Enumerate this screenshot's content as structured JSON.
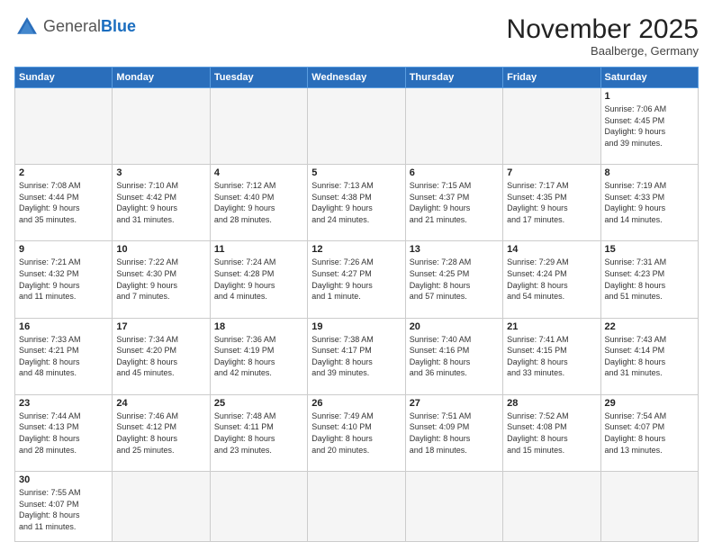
{
  "header": {
    "logo_general": "General",
    "logo_blue": "Blue",
    "month_title": "November 2025",
    "location": "Baalberge, Germany"
  },
  "weekdays": [
    "Sunday",
    "Monday",
    "Tuesday",
    "Wednesday",
    "Thursday",
    "Friday",
    "Saturday"
  ],
  "weeks": [
    [
      {
        "day": "",
        "info": ""
      },
      {
        "day": "",
        "info": ""
      },
      {
        "day": "",
        "info": ""
      },
      {
        "day": "",
        "info": ""
      },
      {
        "day": "",
        "info": ""
      },
      {
        "day": "",
        "info": ""
      },
      {
        "day": "1",
        "info": "Sunrise: 7:06 AM\nSunset: 4:45 PM\nDaylight: 9 hours\nand 39 minutes."
      }
    ],
    [
      {
        "day": "2",
        "info": "Sunrise: 7:08 AM\nSunset: 4:44 PM\nDaylight: 9 hours\nand 35 minutes."
      },
      {
        "day": "3",
        "info": "Sunrise: 7:10 AM\nSunset: 4:42 PM\nDaylight: 9 hours\nand 31 minutes."
      },
      {
        "day": "4",
        "info": "Sunrise: 7:12 AM\nSunset: 4:40 PM\nDaylight: 9 hours\nand 28 minutes."
      },
      {
        "day": "5",
        "info": "Sunrise: 7:13 AM\nSunset: 4:38 PM\nDaylight: 9 hours\nand 24 minutes."
      },
      {
        "day": "6",
        "info": "Sunrise: 7:15 AM\nSunset: 4:37 PM\nDaylight: 9 hours\nand 21 minutes."
      },
      {
        "day": "7",
        "info": "Sunrise: 7:17 AM\nSunset: 4:35 PM\nDaylight: 9 hours\nand 17 minutes."
      },
      {
        "day": "8",
        "info": "Sunrise: 7:19 AM\nSunset: 4:33 PM\nDaylight: 9 hours\nand 14 minutes."
      }
    ],
    [
      {
        "day": "9",
        "info": "Sunrise: 7:21 AM\nSunset: 4:32 PM\nDaylight: 9 hours\nand 11 minutes."
      },
      {
        "day": "10",
        "info": "Sunrise: 7:22 AM\nSunset: 4:30 PM\nDaylight: 9 hours\nand 7 minutes."
      },
      {
        "day": "11",
        "info": "Sunrise: 7:24 AM\nSunset: 4:28 PM\nDaylight: 9 hours\nand 4 minutes."
      },
      {
        "day": "12",
        "info": "Sunrise: 7:26 AM\nSunset: 4:27 PM\nDaylight: 9 hours\nand 1 minute."
      },
      {
        "day": "13",
        "info": "Sunrise: 7:28 AM\nSunset: 4:25 PM\nDaylight: 8 hours\nand 57 minutes."
      },
      {
        "day": "14",
        "info": "Sunrise: 7:29 AM\nSunset: 4:24 PM\nDaylight: 8 hours\nand 54 minutes."
      },
      {
        "day": "15",
        "info": "Sunrise: 7:31 AM\nSunset: 4:23 PM\nDaylight: 8 hours\nand 51 minutes."
      }
    ],
    [
      {
        "day": "16",
        "info": "Sunrise: 7:33 AM\nSunset: 4:21 PM\nDaylight: 8 hours\nand 48 minutes."
      },
      {
        "day": "17",
        "info": "Sunrise: 7:34 AM\nSunset: 4:20 PM\nDaylight: 8 hours\nand 45 minutes."
      },
      {
        "day": "18",
        "info": "Sunrise: 7:36 AM\nSunset: 4:19 PM\nDaylight: 8 hours\nand 42 minutes."
      },
      {
        "day": "19",
        "info": "Sunrise: 7:38 AM\nSunset: 4:17 PM\nDaylight: 8 hours\nand 39 minutes."
      },
      {
        "day": "20",
        "info": "Sunrise: 7:40 AM\nSunset: 4:16 PM\nDaylight: 8 hours\nand 36 minutes."
      },
      {
        "day": "21",
        "info": "Sunrise: 7:41 AM\nSunset: 4:15 PM\nDaylight: 8 hours\nand 33 minutes."
      },
      {
        "day": "22",
        "info": "Sunrise: 7:43 AM\nSunset: 4:14 PM\nDaylight: 8 hours\nand 31 minutes."
      }
    ],
    [
      {
        "day": "23",
        "info": "Sunrise: 7:44 AM\nSunset: 4:13 PM\nDaylight: 8 hours\nand 28 minutes."
      },
      {
        "day": "24",
        "info": "Sunrise: 7:46 AM\nSunset: 4:12 PM\nDaylight: 8 hours\nand 25 minutes."
      },
      {
        "day": "25",
        "info": "Sunrise: 7:48 AM\nSunset: 4:11 PM\nDaylight: 8 hours\nand 23 minutes."
      },
      {
        "day": "26",
        "info": "Sunrise: 7:49 AM\nSunset: 4:10 PM\nDaylight: 8 hours\nand 20 minutes."
      },
      {
        "day": "27",
        "info": "Sunrise: 7:51 AM\nSunset: 4:09 PM\nDaylight: 8 hours\nand 18 minutes."
      },
      {
        "day": "28",
        "info": "Sunrise: 7:52 AM\nSunset: 4:08 PM\nDaylight: 8 hours\nand 15 minutes."
      },
      {
        "day": "29",
        "info": "Sunrise: 7:54 AM\nSunset: 4:07 PM\nDaylight: 8 hours\nand 13 minutes."
      }
    ],
    [
      {
        "day": "30",
        "info": "Sunrise: 7:55 AM\nSunset: 4:07 PM\nDaylight: 8 hours\nand 11 minutes."
      },
      {
        "day": "",
        "info": ""
      },
      {
        "day": "",
        "info": ""
      },
      {
        "day": "",
        "info": ""
      },
      {
        "day": "",
        "info": ""
      },
      {
        "day": "",
        "info": ""
      },
      {
        "day": "",
        "info": ""
      }
    ]
  ]
}
